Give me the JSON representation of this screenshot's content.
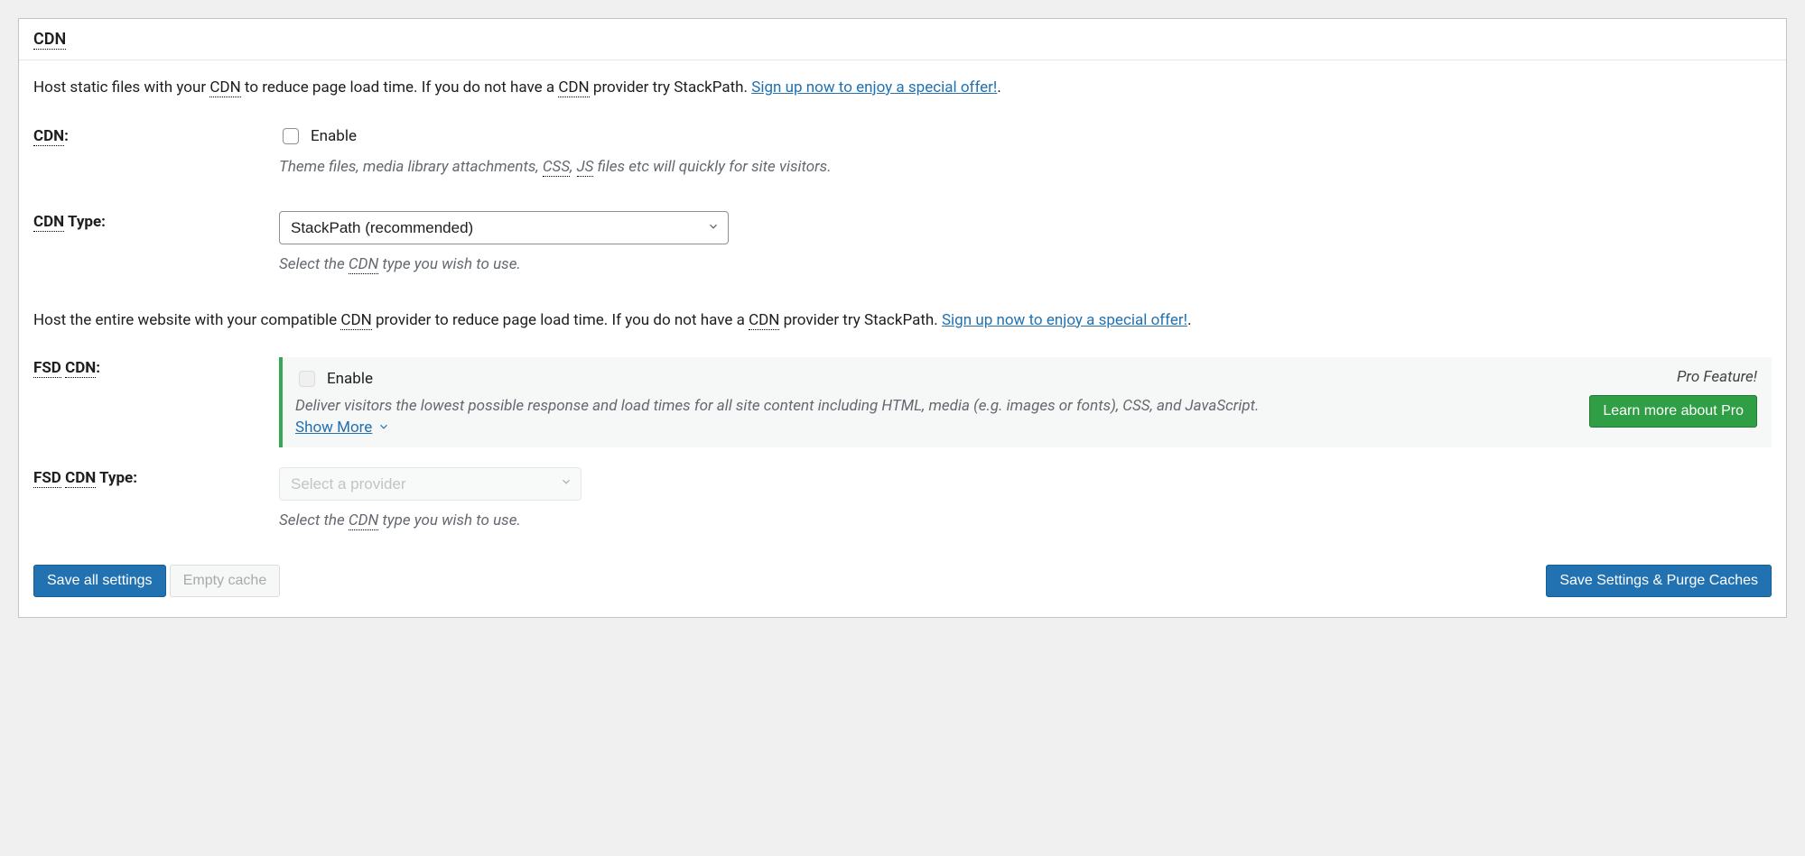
{
  "header": {
    "title": "CDN"
  },
  "intro1": {
    "text_pre": "Host static files with your ",
    "cdn1": "CDN",
    "text_mid": " to reduce page load time. If you do not have a ",
    "cdn2": "CDN",
    "text_post": " provider try StackPath. ",
    "link": "Sign up now to enjoy a special offer!",
    "period": "."
  },
  "row_cdn": {
    "label_abbr": "CDN",
    "label_suffix": ":",
    "enable": "Enable",
    "desc_pre": "Theme files, media library attachments, ",
    "css": "CSS",
    "comma": ", ",
    "js": "JS",
    "desc_post": " files etc will quickly for site visitors."
  },
  "row_cdn_type": {
    "label_abbr": "CDN",
    "label_suffix": " Type:",
    "selected": "StackPath (recommended)",
    "desc_pre": "Select the ",
    "cdn": "CDN",
    "desc_post": " type you wish to use."
  },
  "intro2": {
    "text_pre": "Host the entire website with your compatible ",
    "cdn1": "CDN",
    "text_mid": " provider to reduce page load time. If you do not have a ",
    "cdn2": "CDN",
    "text_post": " provider try StackPath. ",
    "link": "Sign up now to enjoy a special offer!",
    "period": "."
  },
  "row_fsd": {
    "label_fsd": "FSD",
    "label_cdn": "CDN",
    "label_suffix": ":",
    "enable": "Enable",
    "desc": "Deliver visitors the lowest possible response and load times for all site content including HTML, media (e.g. images or fonts), CSS, and JavaScript.",
    "show_more": "Show More",
    "pro_feature": "Pro Feature!",
    "learn_more": "Learn more about Pro"
  },
  "row_fsd_type": {
    "label_fsd": "FSD",
    "label_cdn": "CDN",
    "label_suffix": " Type:",
    "placeholder": "Select a provider",
    "desc_pre": "Select the ",
    "cdn": "CDN",
    "desc_post": " type you wish to use."
  },
  "footer": {
    "save_all": "Save all settings",
    "empty_cache": "Empty cache",
    "save_purge": "Save Settings & Purge Caches"
  }
}
